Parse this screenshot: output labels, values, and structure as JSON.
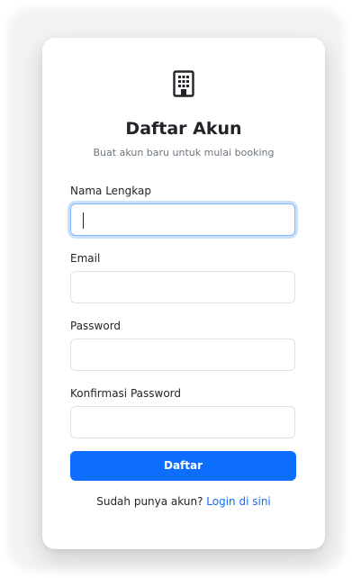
{
  "form": {
    "logo_icon": "building-icon",
    "title": "Daftar Akun",
    "subtitle": "Buat akun baru untuk mulai booking",
    "fields": [
      {
        "label": "Nama Lengkap",
        "value": "",
        "focused": true
      },
      {
        "label": "Email",
        "value": ""
      },
      {
        "label": "Password",
        "value": ""
      },
      {
        "label": "Konfirmasi Password",
        "value": ""
      }
    ],
    "submit_label": "Daftar",
    "footer_text": "Sudah punya akun?",
    "login_link_label": "Login di sini"
  },
  "colors": {
    "primary": "#0d6efd",
    "text": "#212529",
    "muted": "#6c757d",
    "border": "#dee2e6",
    "focus_border": "#86b7fe"
  }
}
